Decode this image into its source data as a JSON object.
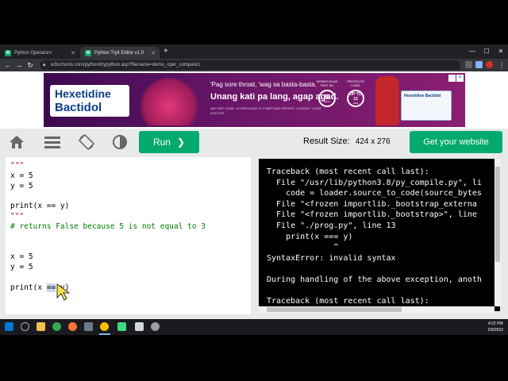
{
  "browser": {
    "tabs": [
      {
        "label": "Python Operators",
        "favicon": "W",
        "active": false
      },
      {
        "label": "Python Tryit Editor v1.0",
        "favicon": "W",
        "active": true
      }
    ],
    "url": "w3schools.com/python/trypython.asp?filename=demo_oper_compare1"
  },
  "ad": {
    "brand_line1": "Hexetidine",
    "brand_line2": "Bactidol",
    "headline": "'Pag sore throat, 'wag sa basta-basta.",
    "headline2": "Unang kati pa lang, agap agad.",
    "fineprint": "ASC REF CODE: JET2P0110226 IF SYMPTOMS PERSIST, CONSULT YOUR DOCTOR",
    "stat1_label": "WORKS IN AS FAST AS",
    "stat1_value": "30",
    "stat1_unit": "SECS",
    "stat2_label": "PROTECTS LONG",
    "stat2_value": "UP TO 12",
    "stat2_unit": "HRS",
    "box_label": "Hexetidine Bactidol"
  },
  "toolbar": {
    "run_label": "Run",
    "result_size_label": "Result Size:",
    "result_size_value": "424 x 276",
    "get_website_label": "Get your website"
  },
  "editor": {
    "lines": [
      {
        "text": "\"\"\"",
        "kind": "str"
      },
      {
        "text": "x = 5",
        "kind": "code"
      },
      {
        "text": "y = 5",
        "kind": "code"
      },
      {
        "text": "",
        "kind": "code"
      },
      {
        "text": "print(x == y)",
        "kind": "code"
      },
      {
        "text": "\"\"\"",
        "kind": "str"
      },
      {
        "text": "# returns False because 5 is not equal to 3",
        "kind": "cmt"
      },
      {
        "text": "",
        "kind": "code"
      },
      {
        "text": "",
        "kind": "code"
      },
      {
        "text": "x = 5",
        "kind": "code"
      },
      {
        "text": "y = 5",
        "kind": "code"
      },
      {
        "text": "",
        "kind": "code"
      },
      {
        "text": "print(x == y)",
        "kind": "code"
      }
    ],
    "highlighted_token": "=="
  },
  "output": {
    "lines": [
      "Traceback (most recent call last):",
      "  File \"/usr/lib/python3.8/py_compile.py\", li",
      "    code = loader.source_to_code(source_bytes",
      "  File \"<frozen importlib._bootstrap_externa",
      "  File \"<frozen importlib._bootstrap>\", line",
      "  File \"./prog.py\", line 13",
      "    print(x === y)",
      "              ^",
      "SyntaxError: invalid syntax",
      "",
      "During handling of the above exception, anoth",
      "",
      "Traceback (most recent call last):"
    ]
  },
  "taskbar": {
    "time": "4:22 PM",
    "date": "2/9/2022"
  },
  "colors": {
    "accent": "#04aa6d",
    "toolbar_bg": "#e7e9eb"
  }
}
